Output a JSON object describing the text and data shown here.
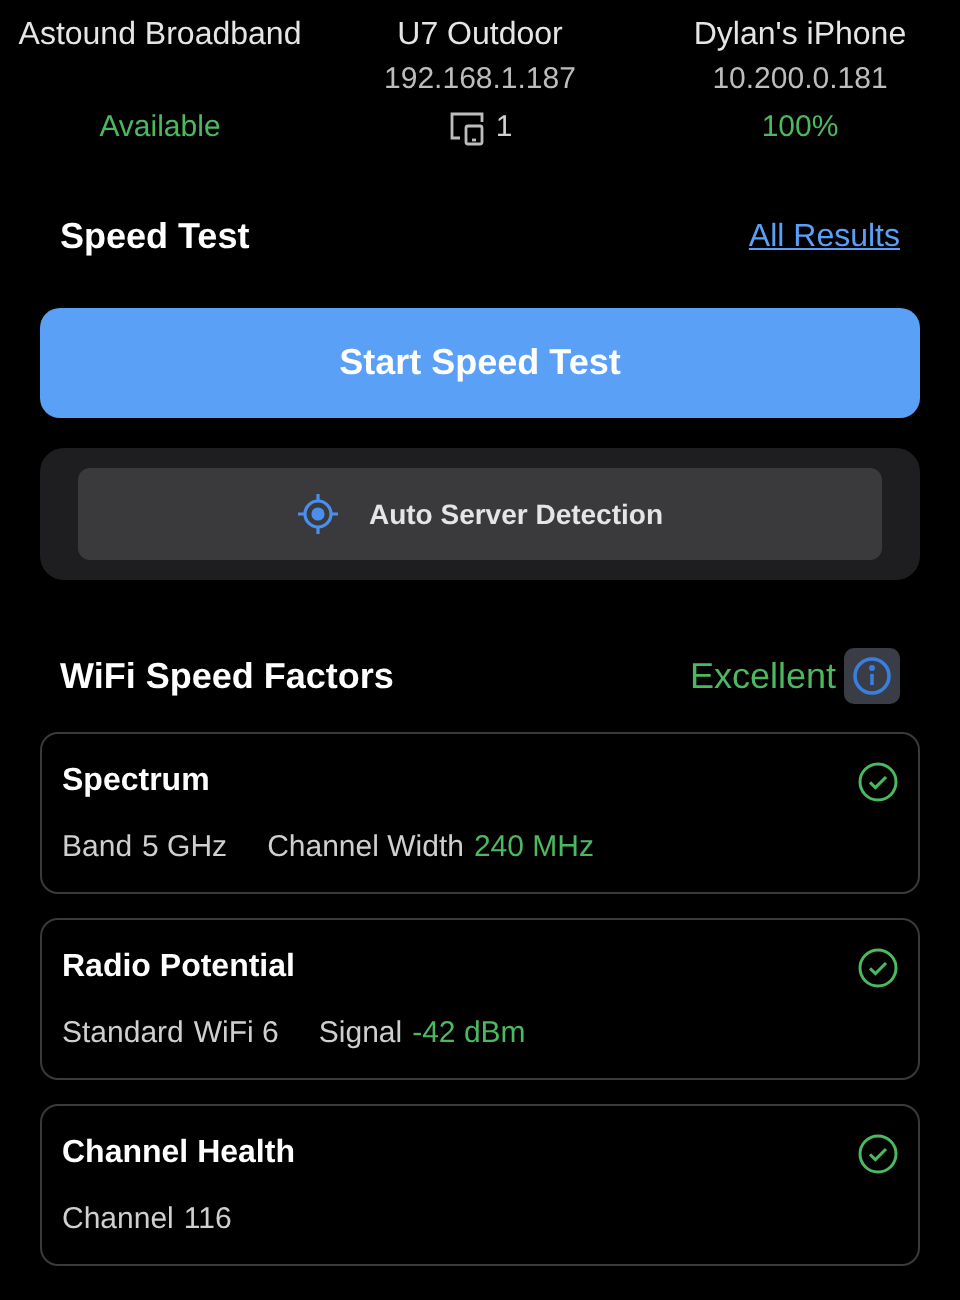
{
  "devices": [
    {
      "name": "Astound Broadband",
      "status": "Available",
      "kind": "isp"
    },
    {
      "name": "U7 Outdoor",
      "detail": "192.168.1.187",
      "status": "1",
      "kind": "ap"
    },
    {
      "name": "Dylan's iPhone",
      "detail": "10.200.0.181",
      "status": "100%",
      "kind": "client"
    }
  ],
  "speed_test": {
    "title": "Speed Test",
    "link": "All Results",
    "start_button": "Start Speed Test",
    "server_button": "Auto Server Detection"
  },
  "factors": {
    "title": "WiFi Speed Factors",
    "rating": "Excellent",
    "items": [
      {
        "title": "Spectrum",
        "ok": true,
        "stats": [
          {
            "label": "Band",
            "value": "5 GHz",
            "highlight": false
          },
          {
            "label": "Channel Width",
            "value": "240 MHz",
            "highlight": true
          }
        ]
      },
      {
        "title": "Radio Potential",
        "ok": true,
        "stats": [
          {
            "label": "Standard",
            "value": "WiFi 6",
            "highlight": false
          },
          {
            "label": "Signal",
            "value": "-42 dBm",
            "highlight": true
          }
        ]
      },
      {
        "title": "Channel Health",
        "ok": true,
        "stats": [
          {
            "label": "Channel",
            "value": "116",
            "highlight": false
          }
        ]
      }
    ]
  }
}
